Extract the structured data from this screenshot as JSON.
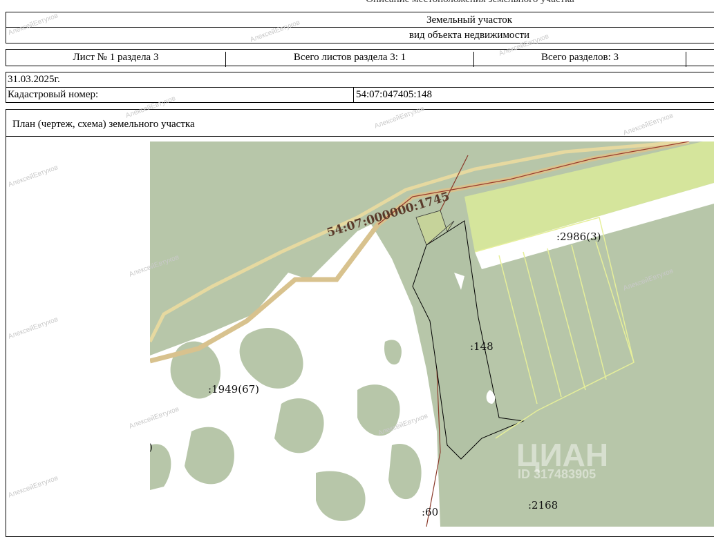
{
  "header": {
    "top_caption": "Описание местоположения земельного участка",
    "object_type": "Земельный участок",
    "object_type_caption": "вид объекта недвижимости"
  },
  "sheet_info": {
    "sheet": "Лист № 1 раздела 3",
    "total_sheets": "Всего листов раздела 3: 1",
    "total_sections": "Всего разделов: 3"
  },
  "record": {
    "date": "31.03.2025г.",
    "cadastral_label": "Кадастровый номер:",
    "cadastral_number": "54:07:047405:148"
  },
  "plan": {
    "title": "План (чертеж, схема) земельного участка",
    "labels": {
      "road": "54:07:000000:1745",
      "parcel_2986": ":2986(3)",
      "parcel_148": ":148",
      "parcel_1949": ":1949(67)",
      "parcel_60": ":60",
      "parcel_2168": ":2168",
      "partial": ")"
    },
    "overlay_logo": "ЦИАН",
    "overlay_id": "ID 317483905",
    "watermark": "АлексейЕвтухов",
    "colors": {
      "forest": "#b7c6a9",
      "open": "#ffffff",
      "field": "#d8e6a0",
      "road": "#c8a878"
    }
  }
}
